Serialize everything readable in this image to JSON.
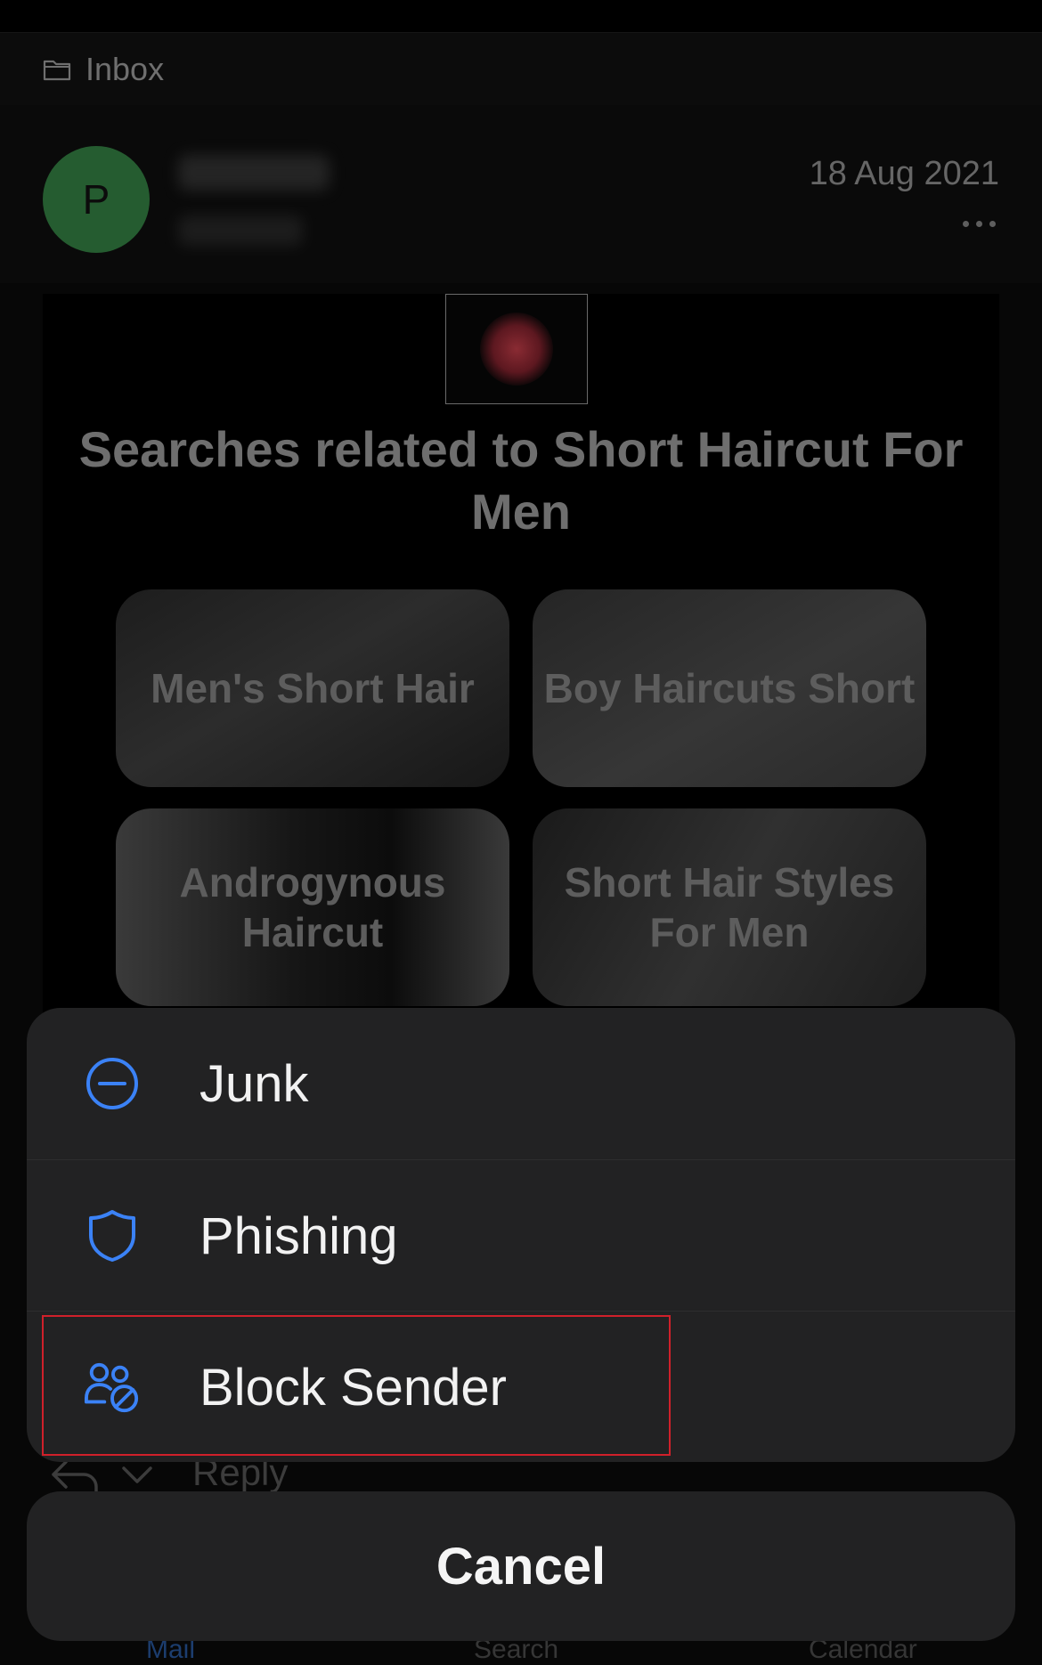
{
  "folder": {
    "label": "Inbox",
    "icon": "folder-icon"
  },
  "email": {
    "avatar_initial": "P",
    "date": "18 Aug 2021",
    "body_title": "Searches related to Short Haircut For Men",
    "tiles": [
      {
        "label": "Men's Short Hair"
      },
      {
        "label": "Boy Haircuts Short"
      },
      {
        "label": "Androgynous Haircut"
      },
      {
        "label": "Short Hair Styles For Men"
      }
    ]
  },
  "reply": {
    "label": "Reply"
  },
  "tabs": {
    "mail": "Mail",
    "search": "Search",
    "calendar": "Calendar"
  },
  "action_sheet": {
    "items": [
      {
        "label": "Junk",
        "icon": "junk-minus-circle-icon"
      },
      {
        "label": "Phishing",
        "icon": "shield-icon"
      },
      {
        "label": "Block Sender",
        "icon": "block-sender-icon"
      }
    ],
    "cancel_label": "Cancel"
  },
  "colors": {
    "accent": "#3b82f6",
    "highlight": "#d0202a",
    "sheet_bg": "#222223",
    "avatar": "#255c30"
  }
}
